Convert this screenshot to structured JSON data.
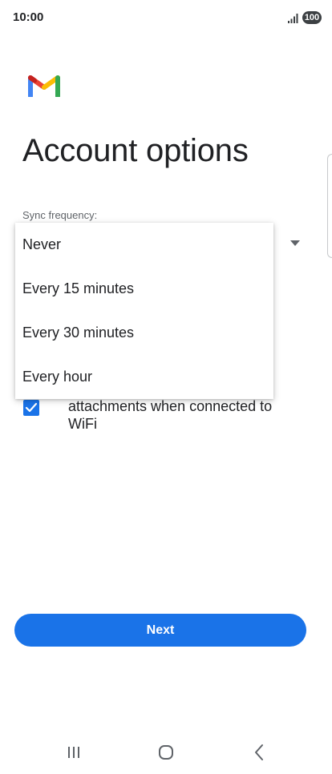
{
  "status_bar": {
    "time": "10:00",
    "battery": "100",
    "signal_icon": "signal-bars-icon"
  },
  "logo": "gmail-logo",
  "page": {
    "title": "Account options"
  },
  "sync": {
    "label": "Sync frequency:",
    "options": [
      "Never",
      "Every 15 minutes",
      "Every 30 minutes",
      "Every hour"
    ]
  },
  "attachments_option": {
    "line1": "attachments when connected to",
    "line2": "WiFi",
    "checked": true
  },
  "actions": {
    "next_label": "Next"
  },
  "nav": {
    "recents_icon": "recents-icon",
    "home_icon": "home-icon",
    "back_icon": "back-icon"
  },
  "colors": {
    "primary": "#1a73e8",
    "text": "#202124",
    "secondary_text": "#5f6368"
  }
}
